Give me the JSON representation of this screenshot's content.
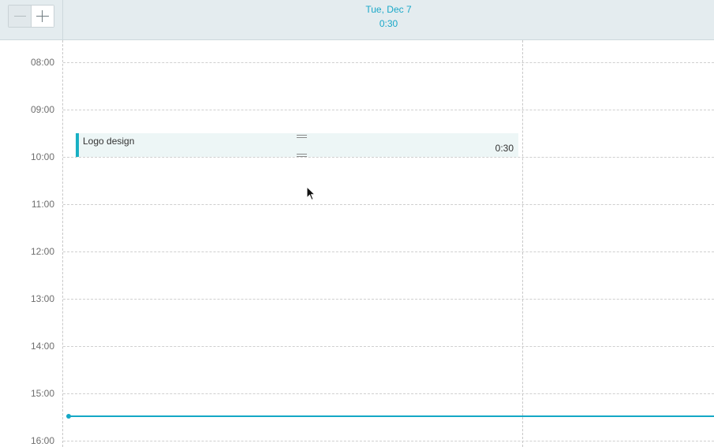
{
  "zoom": {
    "out_icon": "minus-icon",
    "in_icon": "plus-icon"
  },
  "day_column": {
    "date": "Tue, Dec 7",
    "total": "0:30"
  },
  "time_axis": [
    "08:00",
    "09:00",
    "10:00",
    "11:00",
    "12:00",
    "13:00",
    "14:00",
    "15:00",
    "16:00"
  ],
  "event": {
    "title": "Logo design",
    "duration": "0:30",
    "accent_color": "#19b0c4",
    "handle_icon": "drag-handle-icon"
  },
  "now_indicator": {
    "color": "#14a8c6"
  },
  "colors": {
    "accent": "#1aa8c8",
    "header_bg": "#e4ecef",
    "event_bg": "#edf6f6"
  }
}
